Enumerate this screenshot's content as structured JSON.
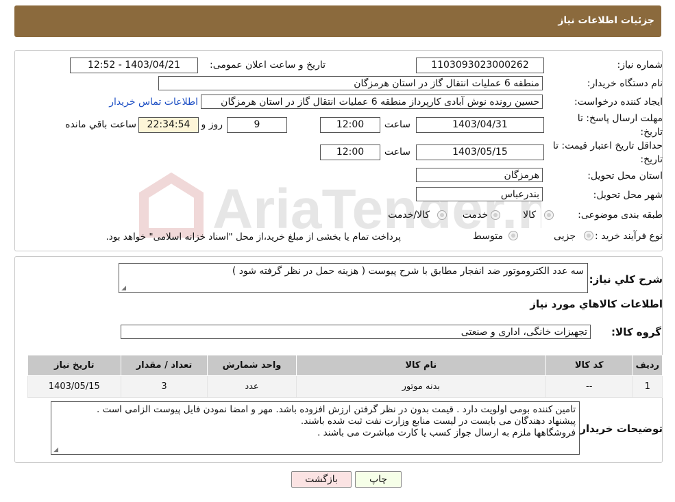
{
  "header": {
    "title": "جزئیات اطلاعات نیاز"
  },
  "watermark": {
    "text": "AriaTender.neT"
  },
  "fields": {
    "need_number_label": "شماره نیاز:",
    "need_number": "1103093023000262",
    "announce_label": "تاریخ و ساعت اعلان عمومی:",
    "announce_value": "1403/04/21 - 12:52",
    "buyer_org_label": "نام دستگاه خریدار:",
    "buyer_org": "منطقه 6 عملیات انتقال گاز در استان هرمزگان",
    "creator_label": "ایجاد کننده درخواست:",
    "creator": "حسین رونده نوش آبادی کارپرداز منطقه 6 عملیات انتقال گاز در استان هرمزگان",
    "contact_link": "اطلاعات تماس خریدار",
    "deadline_label_1": "مهلت ارسال پاسخ: تا",
    "deadline_label_2": "تاریخ:",
    "deadline_date": "1403/04/31",
    "time_label": "ساعت",
    "deadline_time": "12:00",
    "days": "9",
    "days_label": "روز و",
    "remaining": "22:34:54",
    "remaining_label": "ساعت باقي مانده",
    "validity_label_1": "حداقل تاریخ اعتبار قیمت: تا",
    "validity_label_2": "تاریخ:",
    "validity_date": "1403/05/15",
    "validity_time": "12:00",
    "province_label": "استان محل تحویل:",
    "province": "هرمزگان",
    "city_label": "شهر محل تحویل:",
    "city": "بندرعباس",
    "category_label": "طبقه بندی موضوعی:",
    "category_options": [
      "کالا",
      "خدمت",
      "کالا/خدمت"
    ],
    "process_label": "نوع فرآیند خرید :",
    "process_options": [
      "جزیی",
      "متوسط"
    ],
    "process_note": "پرداخت تمام یا بخشی از مبلغ خرید،از محل \"اسناد خزانه اسلامی\" خواهد بود."
  },
  "description": {
    "label": "شرح كلي نياز:",
    "text": "سه عدد الکتروموتور ضد انفجار مطابق با شرح پیوست ( هزینه حمل در نظر گرفته شود )"
  },
  "goods": {
    "section_title": "اطلاعات كالاهاي مورد نياز",
    "group_label": "گروه کالا:",
    "group_value": "تجهیزات خانگی، اداری و صنعتی",
    "columns": [
      "رديف",
      "كد كالا",
      "نام كالا",
      "واحد شمارش",
      "تعداد / مقدار",
      "تاريخ نياز"
    ],
    "rows": [
      [
        "1",
        "--",
        "بدنه موتور",
        "عدد",
        "3",
        "1403/05/15"
      ]
    ]
  },
  "buyer_notes": {
    "label": "توضیحات خریدار:",
    "lines": [
      "تامین کننده بومی اولویت دارد . قیمت بدون در نظر گرفتن  ارزش افزوده باشد. مهر و امضا نمودن فایل  پیوست الزامی است .",
      "پیشنهاد دهندگان می بایست در لیست منابع وزارت نفت ثبت شده  باشند.",
      "فروشگاهها ملزم به ارسال جواز کسب یا کارت مباشرت می باشند ."
    ]
  },
  "buttons": {
    "back": "بازگشت",
    "print": "چاپ"
  },
  "colors": {
    "header": "#8b6a3d",
    "link": "#1d4fc4",
    "back_button": "#fbe3e3",
    "print_button": "#f6ffe8"
  }
}
